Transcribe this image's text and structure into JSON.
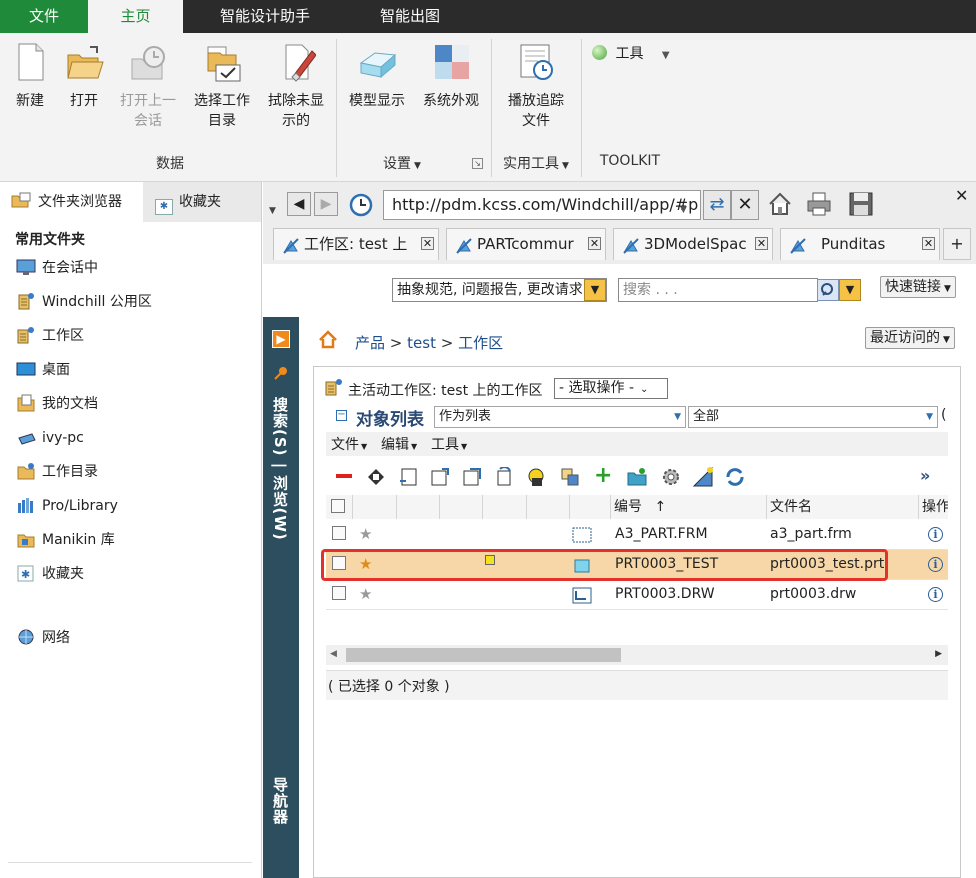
{
  "menubar": {
    "tabs": [
      "文件",
      "主页",
      "智能设计助手",
      "智能出图"
    ]
  },
  "ribbon": {
    "buttons": [
      {
        "label1": "新建",
        "label2": ""
      },
      {
        "label1": "打开",
        "label2": ""
      },
      {
        "label1": "打开上一",
        "label2": "会话"
      },
      {
        "label1": "选择工作",
        "label2": "目录"
      },
      {
        "label1": "拭除未显",
        "label2": "示的"
      },
      {
        "label1": "模型显示",
        "label2": ""
      },
      {
        "label1": "系统外观",
        "label2": ""
      },
      {
        "label1": "播放追踪",
        "label2": "文件"
      }
    ],
    "tools_label": "工具",
    "groups": [
      "数据",
      "设置",
      "实用工具",
      "TOOLKIT"
    ]
  },
  "leftpanel": {
    "tabs": [
      "文件夹浏览器",
      "收藏夹"
    ],
    "section_title": "常用文件夹",
    "items": [
      "在会话中",
      "Windchill 公用区",
      "工作区",
      "桌面",
      "我的文档",
      "ivy-pc",
      "工作目录",
      "Pro/Library",
      "Manikin 库",
      "收藏夹",
      "网络"
    ]
  },
  "browser": {
    "url": "http://pdm.kcss.com/Windchill/app/#p",
    "tabs": [
      "工作区: test 上",
      "PARTcommur",
      "3DModelSpac",
      "Punditas"
    ],
    "plus": "+"
  },
  "page": {
    "search_scope": "抽象规范, 问题报告, 更改请求",
    "search_placeholder": "搜索 . . .",
    "quick_links": "快速链接",
    "breadcrumb": [
      "产品",
      ">",
      "test",
      ">",
      "工作区"
    ],
    "recent": "最近访问的",
    "nav_search": "搜索(S)",
    "nav_sep": "|",
    "nav_browse": "浏览(W)",
    "nav_navigator": "导航器"
  },
  "workspace": {
    "title": "主活动工作区: test 上的工作区",
    "select_action": "- 选取操作 -",
    "list_title": "对象列表",
    "view_as": "作为列表",
    "filter": "全部",
    "menus": [
      "文件",
      "编辑",
      "工具"
    ],
    "more": "»",
    "columns": [
      "编号",
      "文件名",
      "操作"
    ],
    "sort_arrow": "↑",
    "rows": [
      {
        "number": "A3_PART.FRM",
        "filename": "a3_part.frm",
        "star": "★"
      },
      {
        "number": "PRT0003_TEST",
        "filename": "prt0003_test.prt",
        "star": "★"
      },
      {
        "number": "PRT0003.DRW",
        "filename": "prt0003.drw",
        "star": "★"
      }
    ],
    "status": "( 已选择 0 个对象 )"
  },
  "colors": {
    "file_tab": "#1f8a3a",
    "nav_strip": "#2d4e5e",
    "highlight_row": "#f7d7a8",
    "highlight_border": "#e3322b"
  }
}
